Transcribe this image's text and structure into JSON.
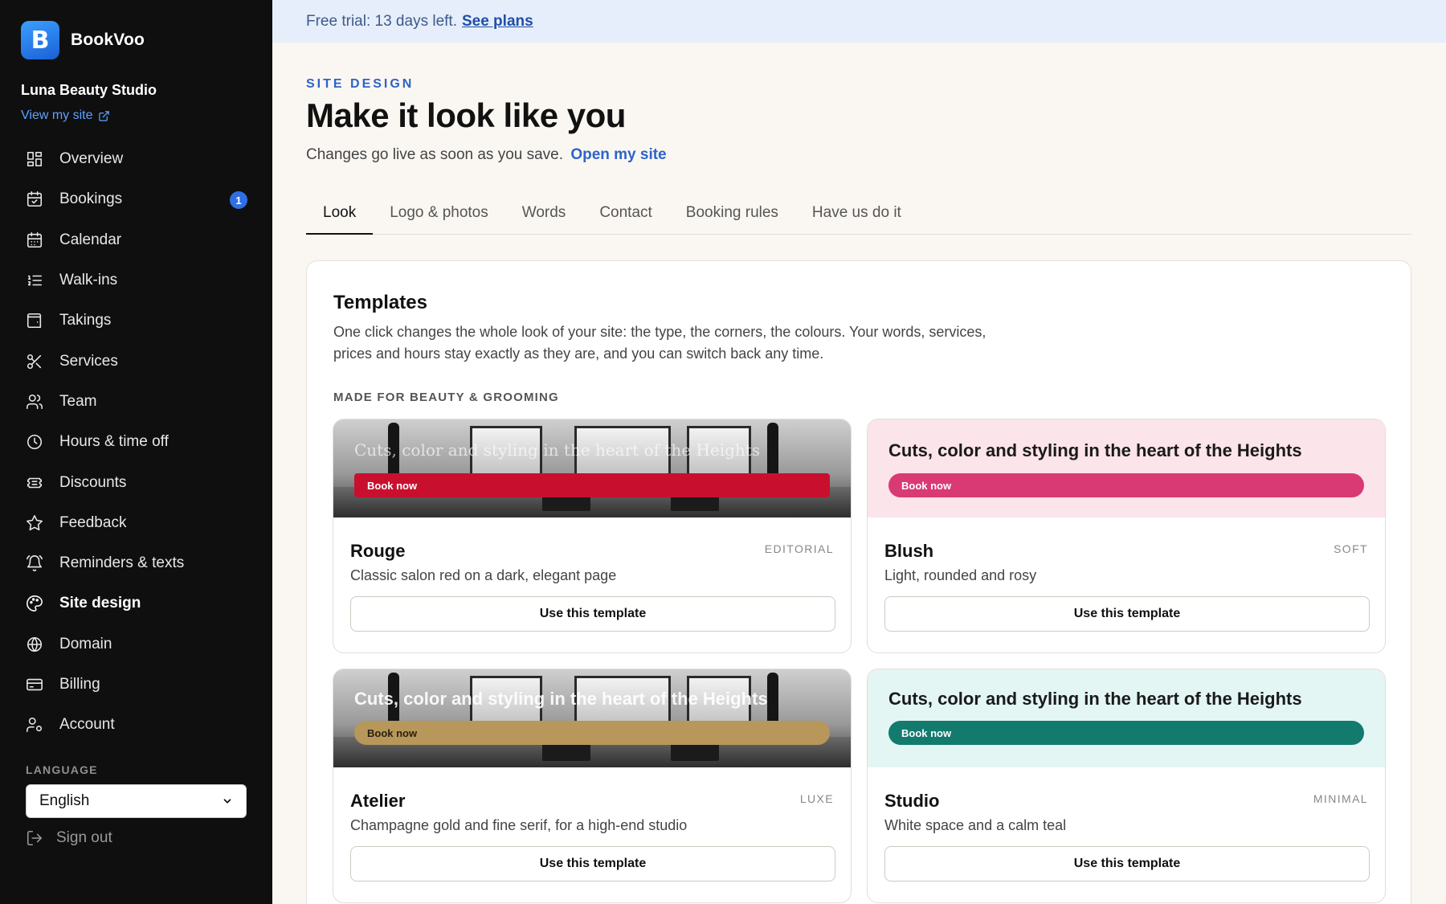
{
  "brand": {
    "name": "BookVoo",
    "mark": "B",
    "accent": "#2f6fe4"
  },
  "sidebar": {
    "studio_name": "Luna Beauty Studio",
    "view_site": "View my site",
    "items": [
      {
        "label": "Overview",
        "icon": "grid-icon"
      },
      {
        "label": "Bookings",
        "icon": "calendar-check-icon",
        "badge": "1"
      },
      {
        "label": "Calendar",
        "icon": "calendar-icon"
      },
      {
        "label": "Walk-ins",
        "icon": "list-ordered-icon"
      },
      {
        "label": "Takings",
        "icon": "wallet-icon"
      },
      {
        "label": "Services",
        "icon": "scissors-icon"
      },
      {
        "label": "Team",
        "icon": "users-icon"
      },
      {
        "label": "Hours & time off",
        "icon": "clock-icon"
      },
      {
        "label": "Discounts",
        "icon": "ticket-icon"
      },
      {
        "label": "Feedback",
        "icon": "star-icon"
      },
      {
        "label": "Reminders & texts",
        "icon": "bell-icon"
      },
      {
        "label": "Site design",
        "icon": "palette-icon",
        "active": true
      },
      {
        "label": "Domain",
        "icon": "globe-icon"
      },
      {
        "label": "Billing",
        "icon": "credit-card-icon"
      },
      {
        "label": "Account",
        "icon": "user-cog-icon"
      }
    ],
    "language_label": "LANGUAGE",
    "language_value": "English",
    "sign_out": "Sign out"
  },
  "trial": {
    "text": "Free trial: 13 days left.",
    "link": "See plans"
  },
  "header": {
    "eyebrow": "SITE DESIGN",
    "title": "Make it look like you",
    "subline": "Changes go live as soon as you save.",
    "subline_link": "Open my site"
  },
  "tabs": [
    {
      "label": "Look",
      "active": true
    },
    {
      "label": "Logo & photos"
    },
    {
      "label": "Words"
    },
    {
      "label": "Contact"
    },
    {
      "label": "Booking rules"
    },
    {
      "label": "Have us do it"
    }
  ],
  "templates": {
    "title": "Templates",
    "description": "One click changes the whole look of your site: the type, the corners, the colours. Your words, services, prices and hours stay exactly as they are, and you can switch back any time.",
    "group_label": "MADE FOR BEAUTY & GROOMING",
    "use_label": "Use this template",
    "preview_headline": "Cuts, color and styling in the heart of the Heights",
    "preview_button": "Book now",
    "cards": [
      {
        "name": "Rouge",
        "tag": "EDITORIAL",
        "desc": "Classic salon red on a dark, elegant page",
        "accent": "#c8102e",
        "style": "photo-serif"
      },
      {
        "name": "Blush",
        "tag": "SOFT",
        "desc": "Light, rounded and rosy",
        "accent": "#d93a74",
        "bg": "#fbe4ea",
        "style": "plain-pill"
      },
      {
        "name": "Atelier",
        "tag": "LUXE",
        "desc": "Champagne gold and fine serif, for a high-end studio",
        "accent": "#b8975a",
        "style": "photo-bold"
      },
      {
        "name": "Studio",
        "tag": "MINIMAL",
        "desc": "White space and a calm teal",
        "accent": "#137a6e",
        "bg": "#e3f6f4",
        "style": "plain-pill"
      }
    ]
  }
}
